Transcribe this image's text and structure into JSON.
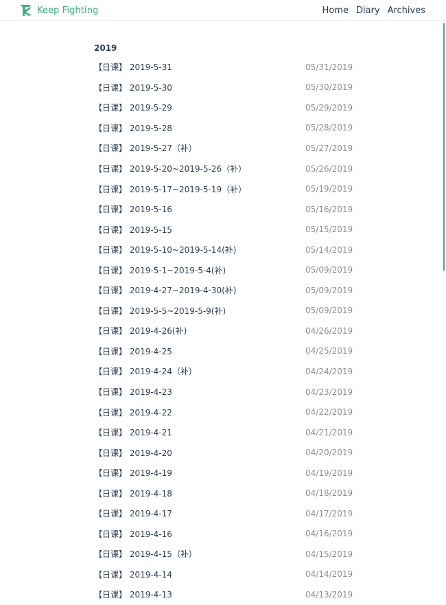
{
  "brand": {
    "name": "Keep Fighting",
    "accent_color": "#3eaf7c",
    "logo_icon": "k-logo-icon"
  },
  "nav": {
    "links": [
      {
        "label": "Home"
      },
      {
        "label": "Diary"
      },
      {
        "label": "Archives"
      }
    ]
  },
  "archive": {
    "year": "2019",
    "posts": [
      {
        "title": "【日课】 2019-5-31",
        "date": "05/31/2019"
      },
      {
        "title": "【日课】 2019-5-30",
        "date": "05/30/2019"
      },
      {
        "title": "【日课】 2019-5-29",
        "date": "05/29/2019"
      },
      {
        "title": "【日课】 2019-5-28",
        "date": "05/28/2019"
      },
      {
        "title": "【日课】 2019-5-27（补）",
        "date": "05/27/2019"
      },
      {
        "title": "【日课】 2019-5-20~2019-5-26（补）",
        "date": "05/26/2019"
      },
      {
        "title": "【日课】 2019-5-17~2019-5-19（补）",
        "date": "05/19/2019"
      },
      {
        "title": "【日课】 2019-5-16",
        "date": "05/16/2019"
      },
      {
        "title": "【日课】 2019-5-15",
        "date": "05/15/2019"
      },
      {
        "title": "【日课】 2019-5-10~2019-5-14(补)",
        "date": "05/14/2019"
      },
      {
        "title": "【日课】 2019-5-1~2019-5-4(补)",
        "date": "05/09/2019"
      },
      {
        "title": "【日课】 2019-4-27~2019-4-30(补)",
        "date": "05/09/2019"
      },
      {
        "title": "【日课】 2019-5-5~2019-5-9(补)",
        "date": "05/09/2019"
      },
      {
        "title": "【日课】 2019-4-26(补)",
        "date": "04/26/2019"
      },
      {
        "title": "【日课】 2019-4-25",
        "date": "04/25/2019"
      },
      {
        "title": "【日课】 2019-4-24（补）",
        "date": "04/24/2019"
      },
      {
        "title": "【日课】 2019-4-23",
        "date": "04/23/2019"
      },
      {
        "title": "【日课】 2019-4-22",
        "date": "04/22/2019"
      },
      {
        "title": "【日课】 2019-4-21",
        "date": "04/21/2019"
      },
      {
        "title": "【日课】 2019-4-20",
        "date": "04/20/2019"
      },
      {
        "title": "【日课】 2019-4-19",
        "date": "04/19/2019"
      },
      {
        "title": "【日课】 2019-4-18",
        "date": "04/18/2019"
      },
      {
        "title": "【日课】 2019-4-17",
        "date": "04/17/2019"
      },
      {
        "title": "【日课】 2019-4-16",
        "date": "04/16/2019"
      },
      {
        "title": "【日课】 2019-4-15（补）",
        "date": "04/15/2019"
      },
      {
        "title": "【日课】 2019-4-14",
        "date": "04/14/2019"
      },
      {
        "title": "【日课】 2019-4-13",
        "date": "04/13/2019"
      }
    ]
  }
}
